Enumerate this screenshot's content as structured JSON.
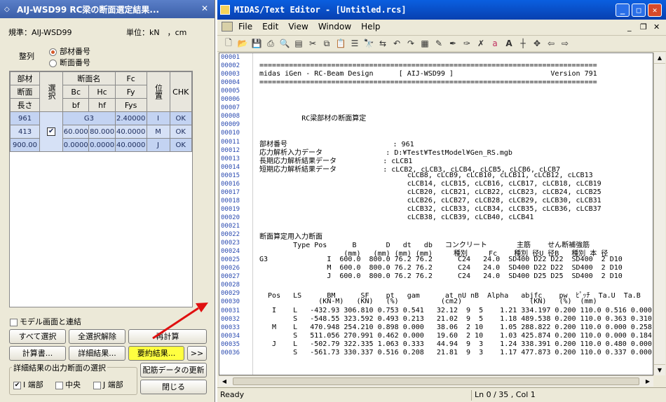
{
  "dialog": {
    "title": "AIJ-WSD99 RC梁の断面選定結果...",
    "standard": "規準：AIJ-WSD99",
    "units": "単位：kN　，cm",
    "sort_label": "整列",
    "sort_options": [
      "部材番号",
      "断面番号"
    ],
    "headers": {
      "r1": [
        "部材",
        "断面名",
        "Fc"
      ],
      "r2": [
        "断面",
        "Bc",
        "Hc",
        "Fy"
      ],
      "r3": [
        "長さ",
        "bf",
        "hf",
        "Fys"
      ],
      "select": "選択",
      "pos": "位置",
      "chk": "CHK"
    },
    "rows": [
      [
        "961",
        "",
        "G3",
        "",
        "2.40000",
        "I",
        "OK"
      ],
      [
        "413",
        "✔",
        "60.000",
        "80.000",
        "40.0000",
        "M",
        "OK"
      ],
      [
        "900.00",
        "",
        "0.0000",
        "0.0000",
        "40.0000",
        "J",
        "OK"
      ]
    ],
    "link_model": "モデル画面と連結",
    "buttons": {
      "select_all": "すべて選択",
      "deselect_all": "全選択解除",
      "recalc": "再計算",
      "calc_book": "計算書...",
      "detail": "詳細結果...",
      "summary": "要約結果...",
      "more": ">>",
      "rebar_update": "配筋データの更新",
      "close": "閉じる"
    },
    "output_group": "詳細結果の出力断面の選択",
    "out_checks": [
      {
        "label": "I 端部",
        "checked": true
      },
      {
        "label": "中央",
        "checked": false
      },
      {
        "label": "J 端部",
        "checked": false
      }
    ]
  },
  "editor": {
    "title": "MIDAS/Text Editor - [Untitled.rcs]",
    "menus": [
      "File",
      "Edit",
      "View",
      "Window",
      "Help"
    ],
    "line_numbers": [
      "00001",
      "00002",
      "00003",
      "00004",
      "00005",
      "00006",
      "00007",
      "00008",
      "00009",
      "00010",
      "00011",
      "00012",
      "00013",
      "00014",
      "00015",
      "00016",
      "00017",
      "00018",
      "00019",
      "00020",
      "00021",
      "00022",
      "00023",
      "00024",
      "00025",
      "00026",
      "00027",
      "00028",
      "00029",
      "00030",
      "00031",
      "00032",
      "00033",
      "00034",
      "00035",
      "00036"
    ],
    "lines": [
      "================================================================================",
      "midas iGen - RC-Beam Design      [ AIJ-WSD99 ]                       Version 791",
      "================================================================================",
      "",
      "",
      "",
      "          RC梁部材の断面算定",
      "",
      "",
      "部材番号                         : 961",
      "応力解析入力データ               : D:¥Test¥TestModel¥Gen_RS.mgb",
      "長期応力解析結果データ           : cLCB1",
      "短期応力解析結果データ           : cLCB2, cLCB3, cLCB4, cLCB5, cLCB6, cLCB7",
      "                                   cLCB8, cLCB9, cLCB10, cLCB11, cLCB12, cLCB13",
      "                                   cLCB14, cLCB15, cLCB16, cLCB17, cLCB18, cLCB19",
      "                                   cLCB20, cLCB21, cLCB22, cLCB23, cLCB24, cLCB25",
      "                                   cLCB26, cLCB27, cLCB28, cLCB29, cLCB30, cLCB31",
      "                                   cLCB32, cLCB33, cLCB34, cLCB35, cLCB36, cLCB37",
      "                                   cLCB38, cLCB39, cLCB40, cLCB41",
      "",
      "断面算定用入力断面",
      "        Type Pos      B       D   dt   db   コンクリート       主筋    せん断補強筋",
      "                    (mm)   (mm) (mm) (mm)     種別     Fc    種別 径U 径B   種別 本 径",
      "G3              I  600.0  800.0 76.2 76.2      C24   24.0  SD400 D22 D22  SD400  2 D10",
      "                M  600.0  800.0 76.2 76.2      C24   24.0  SD400 D22 D22  SD400  2 D10",
      "                J  600.0  800.0 76.2 76.2      C24   24.0  SD400 D25 D25  SD400  2 D10",
      "",
      "  Pos   LS      BM      SF    pt   gam      at nU nB  Alpha   abjfc    pw  ﾋﾟｯﾁ  Ta.U  Ta.B",
      "              (KN-M)   (KN)   (%)          (cm2)                (KN)   (%)  (mm)",
      "   I    L   -432.93 306.810 0.753 0.541   32.12  9  5    1.21 334.197 0.200 110.0 0.516 0.000",
      "        S   -548.55 323.592 0.493 0.213   21.02  9  5    1.18 489.538 0.200 110.0 0.363 0.310",
      "   M    L   470.948 254.210 0.898 0.000   38.06  2 10    1.05 288.822 0.200 110.0 0.000 0.258",
      "        S   511.056 270.991 0.462 0.000   19.60  2 10    1.03 425.874 0.200 110.0 0.000 0.184",
      "   J    L   -502.79 322.335 1.063 0.333   44.94  9  3    1.24 338.391 0.200 110.0 0.480 0.000",
      "        S   -561.73 330.337 0.516 0.208   21.81  9  3    1.17 477.873 0.200 110.0 0.337 0.000",
      ""
    ],
    "status_ready": "Ready",
    "status_pos": "Ln 0 / 35 , Col 1"
  }
}
